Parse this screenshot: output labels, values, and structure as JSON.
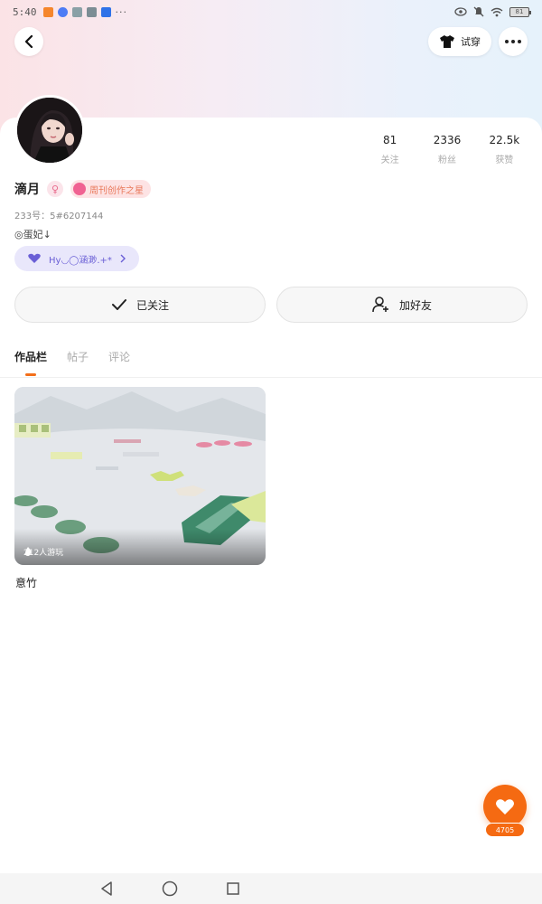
{
  "status_bar": {
    "time": "5:40",
    "battery": "81",
    "app_icon_colors": [
      "#f5862c",
      "#4d7cf5",
      "#8aa0a6",
      "#7c8d94",
      "#2f72e8"
    ]
  },
  "header": {
    "try_on_label": "试穿"
  },
  "profile": {
    "name": "滴月",
    "gender_symbol": "♀",
    "creator_badge": "周刊创作之星",
    "user_id": "233号：5#6207144",
    "bio": "◎蛋妃↓",
    "group_pill": "Hy◡◯涵渺.+*"
  },
  "stats": [
    {
      "value": "81",
      "label": "关注"
    },
    {
      "value": "2336",
      "label": "粉丝"
    },
    {
      "value": "22.5k",
      "label": "获赞"
    }
  ],
  "actions": {
    "follow_label": "已关注",
    "add_friend_label": "加好友"
  },
  "tabs": [
    {
      "label": "作品栏",
      "active": true
    },
    {
      "label": "帖子",
      "active": false
    },
    {
      "label": "评论",
      "active": false
    }
  ],
  "works": [
    {
      "title": "意竹",
      "play_count": "212人游玩"
    }
  ],
  "like": {
    "count": "4705"
  },
  "colors": {
    "accent": "#f56a12",
    "header_left": "#fbe3e6",
    "header_right": "#e6f2fb",
    "group_pill_bg": "#e9e7fb"
  }
}
